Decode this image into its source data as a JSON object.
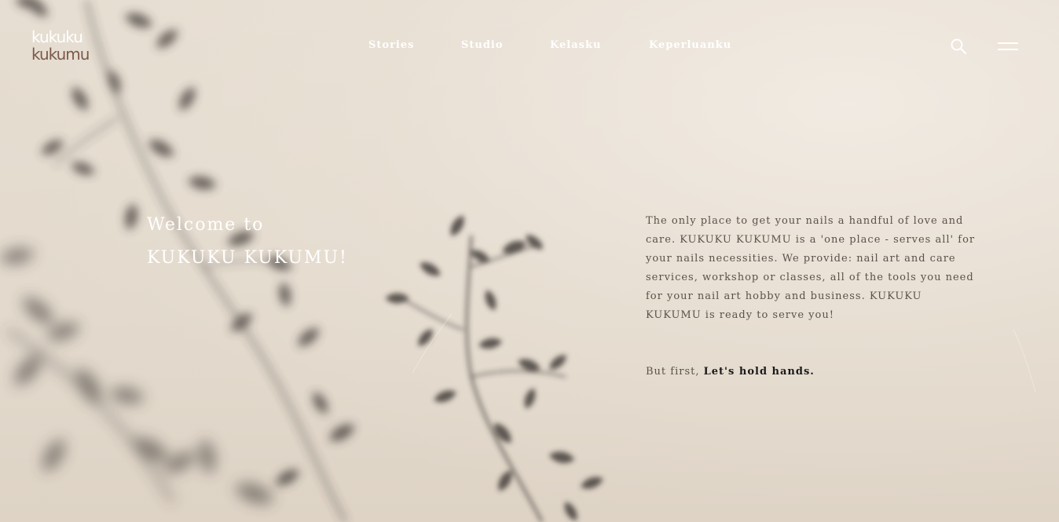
{
  "brand": {
    "logo_line1": "kukuku",
    "logo_line2": "kukumu"
  },
  "nav": {
    "items": [
      {
        "label": "Stories"
      },
      {
        "label": "Studio"
      },
      {
        "label": "Kelasku"
      },
      {
        "label": "Keperluanku"
      }
    ]
  },
  "header_icons": {
    "search": "search-icon",
    "menu": "hamburger-menu-icon"
  },
  "hero": {
    "welcome_line1": "Welcome to",
    "welcome_line2": "KUKUKU KUKUMU!",
    "intro": "The only place to get your nails a handful of love and care. KUKUKU KUKUMU is a 'one place - serves all' for your nails necessities. We provide: nail art and care services, workshop or classes, all of the tools you need for your nail art hobby and business. KUKUKU KUKUMU is ready to serve you!",
    "cta_prefix": "But first,",
    "cta_link": "Let's hold hands."
  },
  "colors": {
    "background": "#e6ddd1",
    "shadow": "#3a3633",
    "logo": "#7a5a4a",
    "nav_text": "#ffffff",
    "body_text": "#5a5148",
    "link_text": "#1a1a1a"
  }
}
